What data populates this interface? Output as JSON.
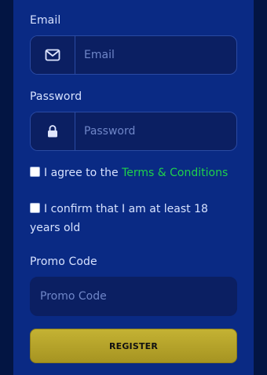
{
  "email": {
    "label": "Email",
    "placeholder": "Email",
    "icon": "envelope-icon"
  },
  "password": {
    "label": "Password",
    "placeholder": "Password",
    "icon": "lock-icon"
  },
  "agreements": {
    "terms_prefix": "I agree to the ",
    "terms_link": "Terms & Conditions",
    "age_text": "I confirm that I am at least 18 years old",
    "terms_checked": false,
    "age_checked": false
  },
  "promo": {
    "label": "Promo Code",
    "placeholder": "Promo Code"
  },
  "register": {
    "label": "REGISTER"
  },
  "colors": {
    "panel": "#0a2a84",
    "link": "#1fd14b",
    "button": "#b6a62b"
  }
}
